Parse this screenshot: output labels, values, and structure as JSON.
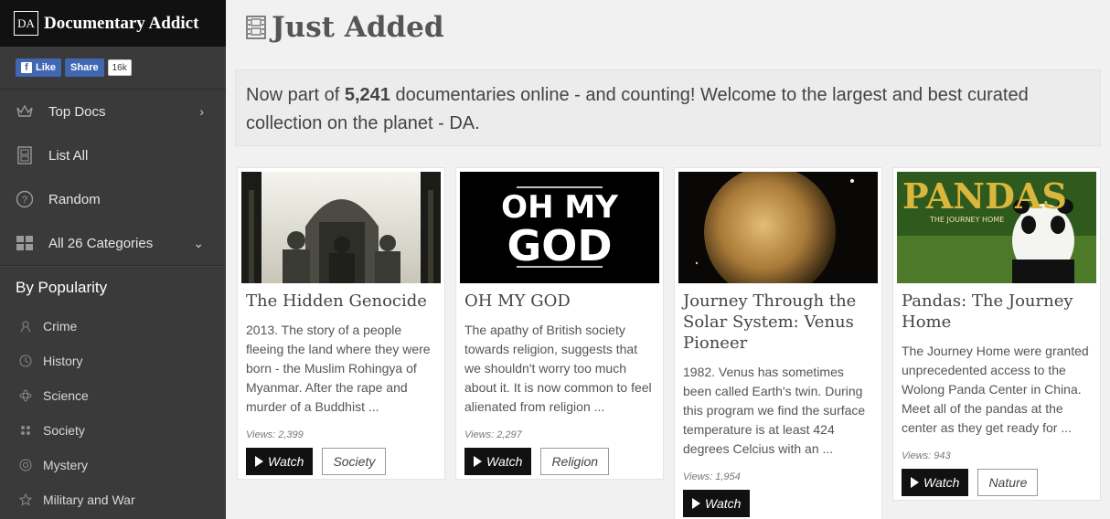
{
  "brand": {
    "logo": "DA",
    "name": "Documentary Addict"
  },
  "social": {
    "like": "Like",
    "share": "Share",
    "count": "16k"
  },
  "nav": [
    {
      "label": "Top Docs",
      "icon": "crown-icon",
      "chevron": "›"
    },
    {
      "label": "List All",
      "icon": "film-icon",
      "chevron": ""
    },
    {
      "label": "Random",
      "icon": "question-icon",
      "chevron": ""
    },
    {
      "label": "All 26 Categories",
      "icon": "grid-icon",
      "chevron": "⌄"
    }
  ],
  "by_popularity": {
    "title": "By Popularity",
    "items": [
      {
        "label": "Crime",
        "icon": "crime-icon"
      },
      {
        "label": "History",
        "icon": "history-icon"
      },
      {
        "label": "Science",
        "icon": "science-icon"
      },
      {
        "label": "Society",
        "icon": "society-icon"
      },
      {
        "label": "Mystery",
        "icon": "mystery-icon"
      },
      {
        "label": "Military and War",
        "icon": "military-icon"
      }
    ]
  },
  "page": {
    "title": "Just Added"
  },
  "intro": {
    "prefix": "Now part of ",
    "count": "5,241",
    "suffix": " documentaries online - and counting! Welcome to the largest and best curated collection on the planet - DA."
  },
  "cards": [
    {
      "title": "The Hidden Genocide",
      "desc": "2013. The story of a people fleeing the land where they were born - the Muslim Rohingya of Myanmar. After the rape and murder of a Buddhist ...",
      "views": "Views: 2,399",
      "watch": "Watch",
      "tag": "Society"
    },
    {
      "title": "OH MY GOD",
      "thumb_text": "OH MY GOD",
      "desc": "The apathy of British society towards religion, suggests that we shouldn't worry too much about it. It is now common to feel alienated from religion ...",
      "views": "Views: 2,297",
      "watch": "Watch",
      "tag": "Religion"
    },
    {
      "title": "Journey Through the Solar System: Venus Pioneer",
      "desc": "1982. Venus has sometimes been called Earth's twin. During this program we find the surface temperature is at least 424 degrees Celcius with an ...",
      "views": "Views: 1,954",
      "watch": "Watch",
      "tag": ""
    },
    {
      "title": "Pandas: The Journey Home",
      "thumb_text": "PANDAS",
      "thumb_sub": "THE JOURNEY HOME",
      "desc": "The Journey Home were granted unprecedented access to the Wolong Panda Center in China. Meet all of the pandas at the center as they get ready for ...",
      "views": "Views: 943",
      "watch": "Watch",
      "tag": "Nature"
    }
  ]
}
